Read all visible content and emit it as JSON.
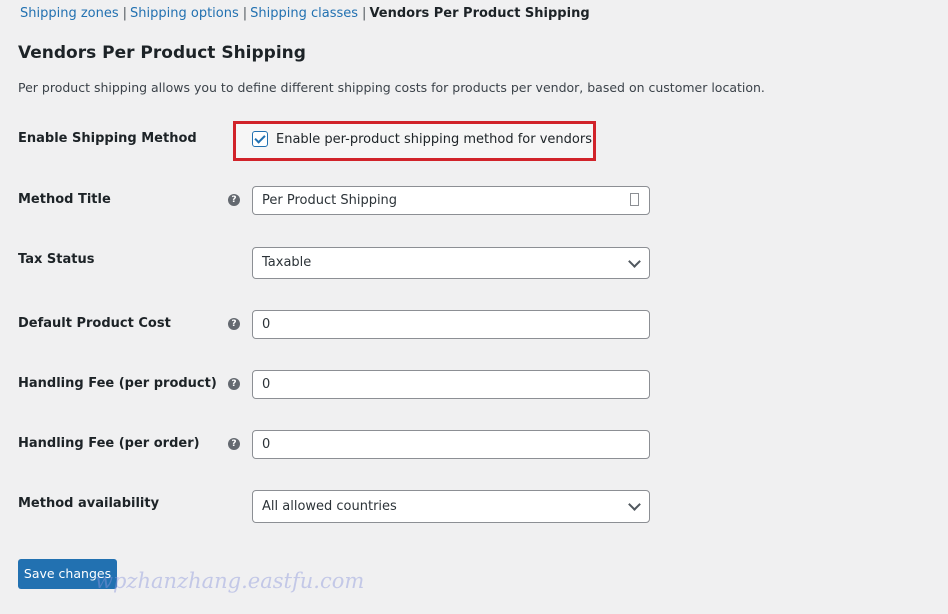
{
  "breadcrumb": {
    "links": [
      "Shipping zones",
      "Shipping options",
      "Shipping classes"
    ],
    "separator": "|",
    "current": "Vendors Per Product Shipping"
  },
  "title": "Vendors Per Product Shipping",
  "description": "Per product shipping allows you to define different shipping costs for products per vendor, based on customer location.",
  "enable": {
    "label": "Enable Shipping Method",
    "checkbox_label": "Enable per-product shipping method for vendors",
    "checked": true,
    "highlight_color": "#d1232a"
  },
  "fields": {
    "method_title": {
      "label": "Method Title",
      "value": "Per Product Shipping",
      "help_icon": "question-circle-icon"
    },
    "tax_status": {
      "label": "Tax Status",
      "value": "Taxable"
    },
    "default_cost": {
      "label": "Default Product Cost",
      "value": "0"
    },
    "fee_product": {
      "label": "Handling Fee (per product)",
      "value": "0"
    },
    "fee_order": {
      "label": "Handling Fee (per order)",
      "value": "0"
    },
    "availability": {
      "label": "Method availability",
      "value": "All allowed countries"
    }
  },
  "help_glyph": "?",
  "save_label": "Save changes",
  "accent": "#2271b1",
  "watermark": "wpzhanzhang.eastfu.com"
}
